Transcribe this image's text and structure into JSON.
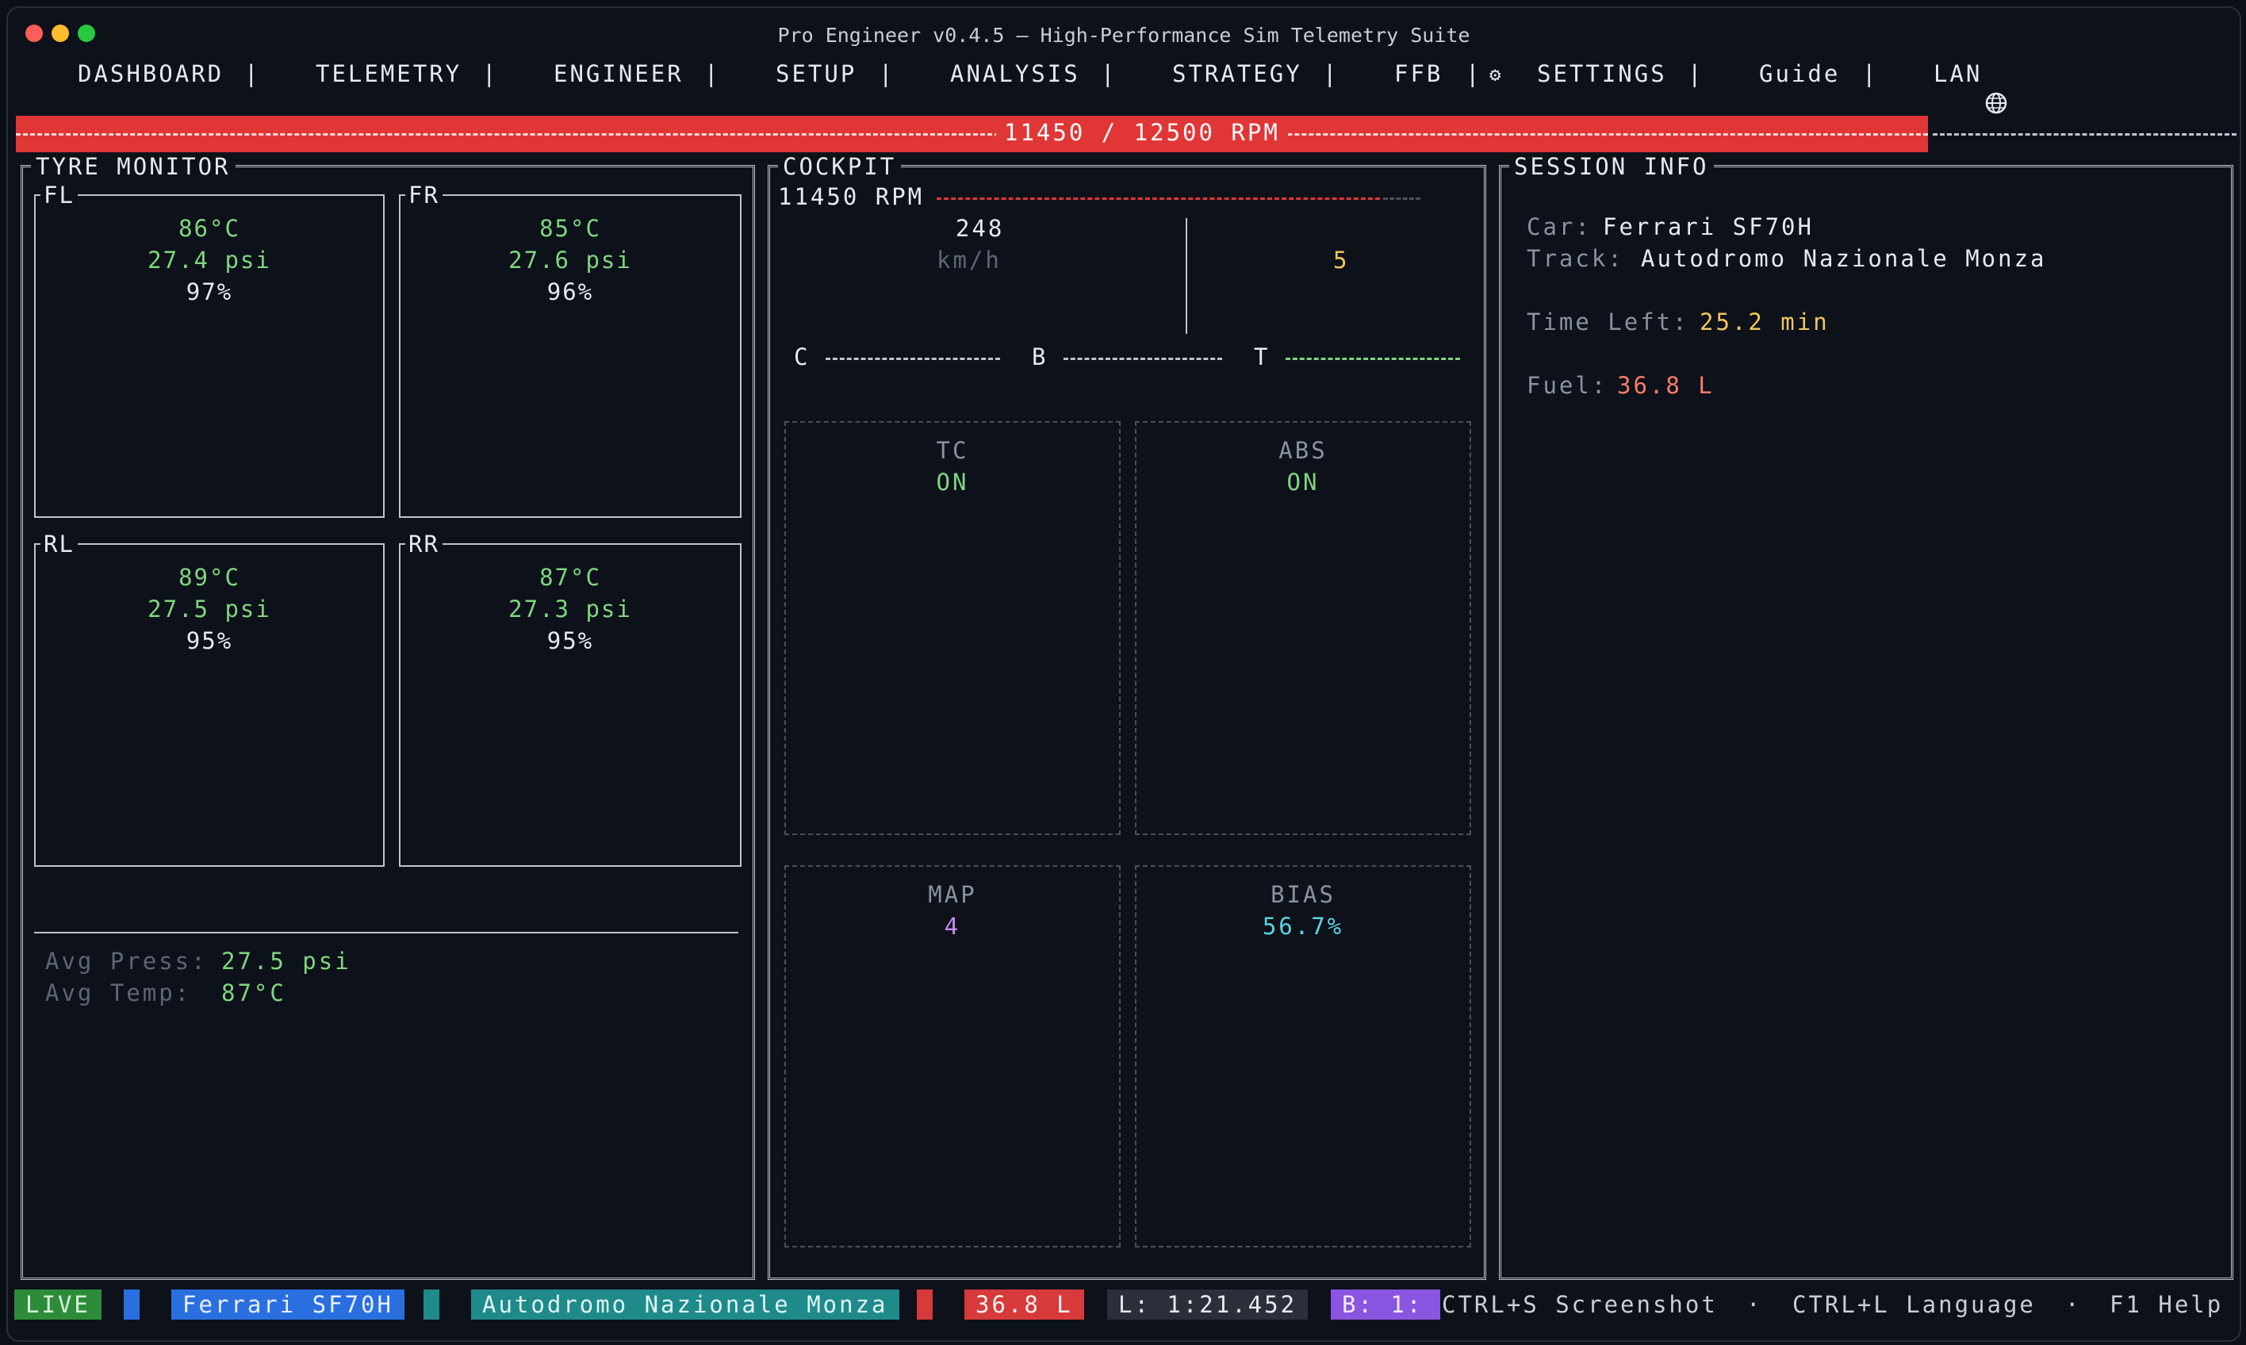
{
  "window": {
    "title": "Pro Engineer v0.4.5 — High-Performance Sim Telemetry Suite"
  },
  "menu": {
    "items": [
      {
        "label": "DASHBOARD"
      },
      {
        "label": "TELEMETRY"
      },
      {
        "label": "ENGINEER"
      },
      {
        "label": "SETUP"
      },
      {
        "label": "ANALYSIS"
      },
      {
        "label": "STRATEGY"
      },
      {
        "label": "FFB"
      },
      {
        "label": "SETTINGS"
      },
      {
        "label": "Guide"
      },
      {
        "label": "LAN"
      }
    ],
    "separator": "|",
    "settings_icon": "gear-icon",
    "lan_icon": "globe-icon"
  },
  "rpm_bar": {
    "text": "11450 / 12500 RPM",
    "current": 11450,
    "max": 12500,
    "color": "#e03636"
  },
  "tyre_monitor": {
    "title": "TYRE MONITOR",
    "tyres": [
      {
        "label": "FL",
        "temp": "86°C",
        "pressure": "27.4 psi",
        "wear": "97%"
      },
      {
        "label": "FR",
        "temp": "85°C",
        "pressure": "27.6 psi",
        "wear": "96%"
      },
      {
        "label": "RL",
        "temp": "89°C",
        "pressure": "27.5 psi",
        "wear": "95%"
      },
      {
        "label": "RR",
        "temp": "87°C",
        "pressure": "27.3 psi",
        "wear": "95%"
      }
    ],
    "avg_press_label": "Avg Press:",
    "avg_press_value": "27.5 psi",
    "avg_temp_label": "Avg Temp:",
    "avg_temp_value": "87°C"
  },
  "cockpit": {
    "title": "COCKPIT",
    "rpm_label": "11450 RPM",
    "rpm_fraction": 0.916,
    "speed": "248",
    "speed_unit": "km/h",
    "gear": "5",
    "pedals": [
      {
        "label": "C"
      },
      {
        "label": "B"
      },
      {
        "label": "T"
      }
    ],
    "cards": [
      {
        "label": "TC",
        "value": "ON",
        "color": "#7fd67f"
      },
      {
        "label": "ABS",
        "value": "ON",
        "color": "#7fd67f"
      },
      {
        "label": "MAP",
        "value": "4",
        "color": "#c58cf0"
      },
      {
        "label": "BIAS",
        "value": "56.7%",
        "color": "#5ad3e0"
      }
    ]
  },
  "session": {
    "title": "SESSION INFO",
    "car_label": "Car:",
    "car_value": "Ferrari SF70H",
    "track_label": "Track:",
    "track_value": "Autodromo Nazionale Monza",
    "time_left_label": "Time Left:",
    "time_left_value": "25.2 min",
    "fuel_label": "Fuel:",
    "fuel_value": "36.8 L"
  },
  "status_bar": {
    "live": "LIVE",
    "car": "Ferrari SF70H",
    "track": "Autodromo Nazionale Monza",
    "fuel": "36.8 L",
    "lap": "L: 1:21.452",
    "brake": "B: 1:",
    "hints": [
      "CTRL+S Screenshot",
      "·",
      "CTRL+L Language",
      "·",
      "F1 Help"
    ]
  }
}
